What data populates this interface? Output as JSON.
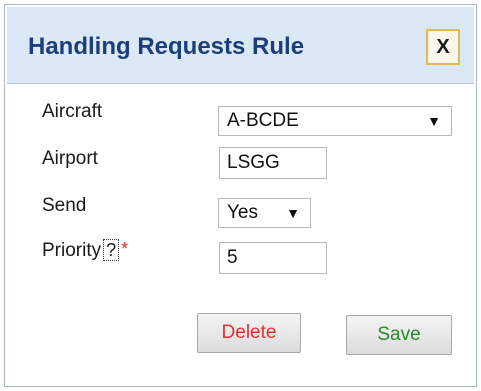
{
  "dialog": {
    "title": "Handling Requests Rule",
    "close_label": "X"
  },
  "form": {
    "aircraft": {
      "label": "Aircraft",
      "value": "A-BCDE"
    },
    "airport": {
      "label": "Airport",
      "value": "LSGG"
    },
    "send": {
      "label": "Send",
      "value": "Yes"
    },
    "priority": {
      "label": "Priority",
      "help": "?",
      "required": "*",
      "value": "5"
    }
  },
  "buttons": {
    "delete_label": "Delete",
    "save_label": "Save"
  },
  "colors": {
    "title": "#1c3f7c",
    "titlebar_bg": "#dbe8f6",
    "delete_text": "#e53030",
    "save_text": "#2a8a2a",
    "required": "#e03030"
  }
}
